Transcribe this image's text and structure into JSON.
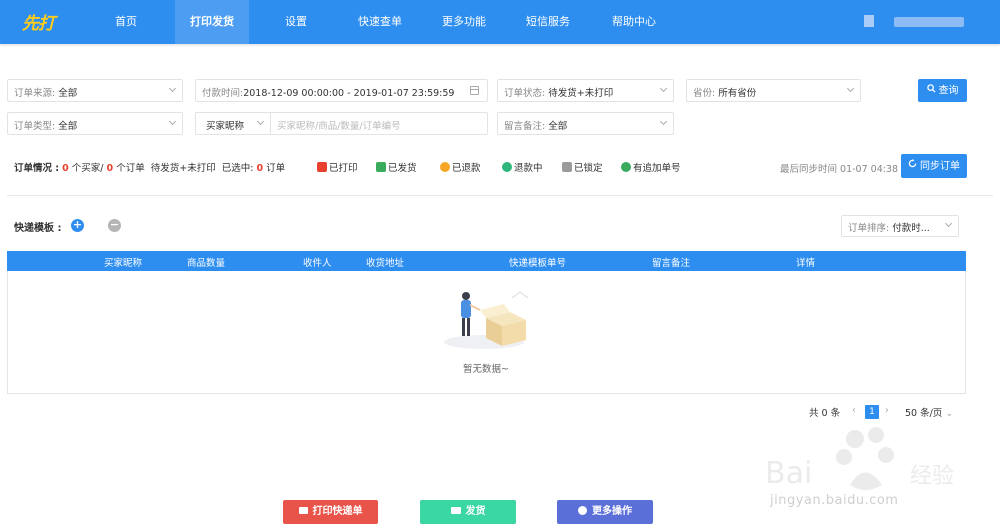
{
  "nav": {
    "logo": "先打",
    "items": [
      "首页",
      "打印发货",
      "设置",
      "快速查单",
      "更多功能",
      "短信服务",
      "帮助中心"
    ]
  },
  "filters": {
    "source_label": "订单来源:",
    "source_value": "全部",
    "paytime_label": "付款时间:",
    "paytime_value": "2018-12-09 00:00:00 - 2019-01-07 23:59:59",
    "status_label": "订单状态:",
    "status_value": "待发货+未打印",
    "province_label": "省份:",
    "province_value": "所有省份",
    "type_label": "订单类型:",
    "type_value": "全部",
    "buyer_select": "买家昵称",
    "buyer_placeholder": "买家昵称/商品/数量/订单编号",
    "remark_label": "留言备注:",
    "remark_value": "全部",
    "query_button": "查询"
  },
  "status_bar": {
    "label": "订单情况 :",
    "buyers_count": "0",
    "buyers_text": "个买家/",
    "orders_count": "0",
    "orders_text": "个订单",
    "filter_text": "待发货+未打印",
    "selected_text": "已选中:",
    "selected_count": "0",
    "selected_unit": "订单"
  },
  "legend": [
    {
      "label": "已打印",
      "color": "#e8402f"
    },
    {
      "label": "已发货",
      "color": "#3aaa5c"
    },
    {
      "label": "已退款",
      "color": "#f5a623"
    },
    {
      "label": "退款中",
      "color": "#2fb67c"
    },
    {
      "label": "已锁定",
      "color": "#9b9b9b"
    },
    {
      "label": "有追加单号",
      "color": "#3aaa5c"
    }
  ],
  "sync": {
    "time_text": "最后同步时间 01-07 04:38",
    "button": "同步订单"
  },
  "template": {
    "label": "快递模板 :"
  },
  "sort": {
    "label": "订单排序:",
    "value": "付款时..."
  },
  "table": {
    "columns": [
      "买家昵称",
      "商品数量",
      "收件人",
      "收货地址",
      "快递模板单号",
      "留言备注",
      "详情"
    ],
    "empty_text": "暂无数据~"
  },
  "pagination": {
    "total": "共 0 条",
    "current": "1",
    "per_page": "50 条/页"
  },
  "actions": {
    "print": "打印快递单",
    "ship": "发货",
    "more": "更多操作"
  },
  "watermark": {
    "text": "jingyan.baidu.com",
    "brand": "Baidu 经验"
  }
}
